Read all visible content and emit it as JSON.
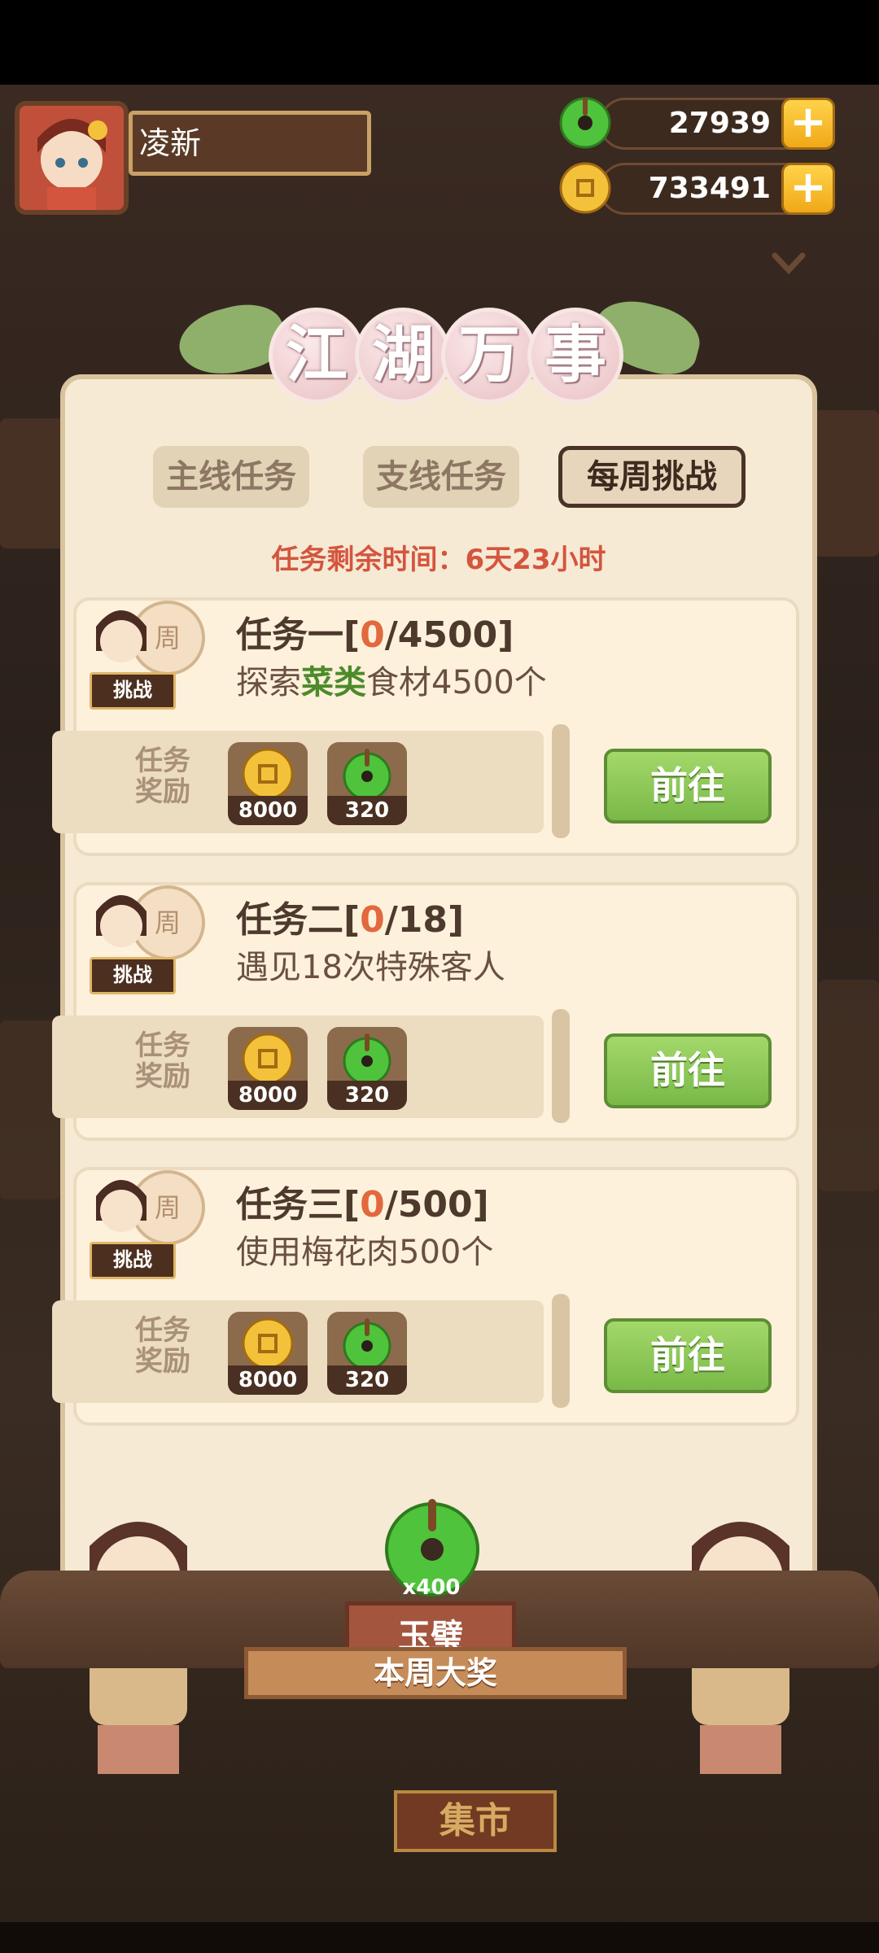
{
  "player": {
    "name": "凌新"
  },
  "currencies": [
    {
      "name": "jade",
      "amount": "27939",
      "color": "#4fc33b"
    },
    {
      "name": "coin",
      "amount": "733491",
      "color": "#f3c23a"
    }
  ],
  "title": [
    "江",
    "湖",
    "万",
    "事"
  ],
  "tabs": [
    {
      "label": "主线任务",
      "active": false
    },
    {
      "label": "支线任务",
      "active": false
    },
    {
      "label": "每周挑战",
      "active": true
    }
  ],
  "timer": "任务剩余时间：6天23小时",
  "badge": {
    "coin_text": "周",
    "label": "挑战"
  },
  "reward_label": "任务奖励",
  "tasks": [
    {
      "title_prefix": "任务一[",
      "progress": "0",
      "title_suffix": "/4500]",
      "desc_before": "探索",
      "desc_highlight": "菜类",
      "desc_after": "食材4500个",
      "rewards": [
        {
          "icon": "gold-coin-icon",
          "count": "8000"
        },
        {
          "icon": "jade-icon",
          "count": "320"
        }
      ],
      "button": "前往"
    },
    {
      "title_prefix": "任务二[",
      "progress": "0",
      "title_suffix": "/18]",
      "desc_before": "遇见18次特殊客人",
      "desc_highlight": "",
      "desc_after": "",
      "rewards": [
        {
          "icon": "gold-coin-icon",
          "count": "8000"
        },
        {
          "icon": "jade-icon",
          "count": "320"
        }
      ],
      "button": "前往"
    },
    {
      "title_prefix": "任务三[",
      "progress": "0",
      "title_suffix": "/500]",
      "desc_before": "使用梅花肉500个",
      "desc_highlight": "",
      "desc_after": "",
      "rewards": [
        {
          "icon": "gold-coin-icon",
          "count": "8000"
        },
        {
          "icon": "jade-icon",
          "count": "320"
        }
      ],
      "button": "前往"
    }
  ],
  "grand_prize": {
    "count": "x400",
    "item": "玉璧",
    "label": "本周大奖"
  },
  "market_sign": "集市"
}
